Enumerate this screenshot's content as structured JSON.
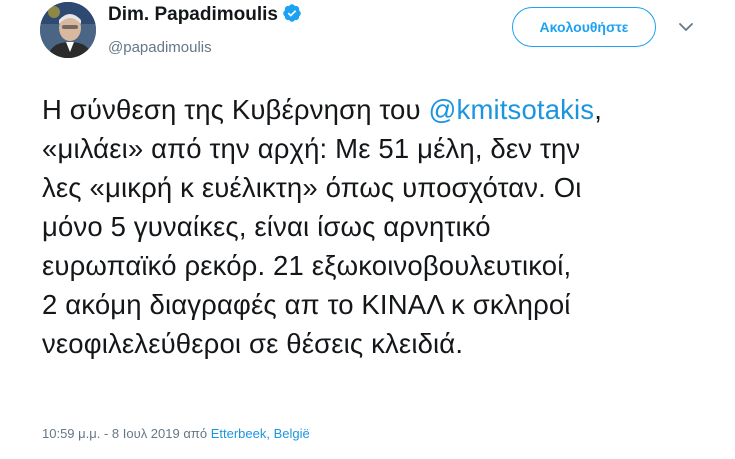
{
  "user": {
    "display_name": "Dim. Papadimoulis",
    "handle": "@papadimoulis",
    "verified_icon": "verified-badge-icon",
    "avatar_icon": "profile-photo"
  },
  "actions": {
    "follow_label": "Ακολουθήστε",
    "menu_icon": "chevron-down-icon"
  },
  "tweet": {
    "lines": [
      {
        "before": "Η σύνθεση της Κυβέρνηση του ",
        "mention": "@kmitsotakis",
        "after": ","
      },
      {
        "text": "«μιλάει» από την αρχή: Με 51 μέλη, δεν την"
      },
      {
        "text": "λες «μικρή κ ευέλικτη» όπως υποσχόταν. Οι"
      },
      {
        "text": "μόνο 5 γυναίκες, είναι ίσως αρνητικό"
      },
      {
        "text": "ευρωπαϊκό ρεκόρ. 21 εξωκοινοβουλευτικοί,"
      },
      {
        "text": "2 ακόμη διαγραφές απ το ΚΙΝΑΛ κ σκληροί"
      },
      {
        "text": "νεοφιλελεύθεροι σε θέσεις κλειδιά."
      }
    ]
  },
  "meta": {
    "timestamp": "10:59 μ.μ. - 8 Ιουλ 2019",
    "from_label": "από",
    "location": "Etterbeek, België"
  },
  "colors": {
    "accent": "#1da1f2",
    "link": "#1b95e0",
    "secondary_text": "#657786",
    "primary_text": "#14171a"
  }
}
